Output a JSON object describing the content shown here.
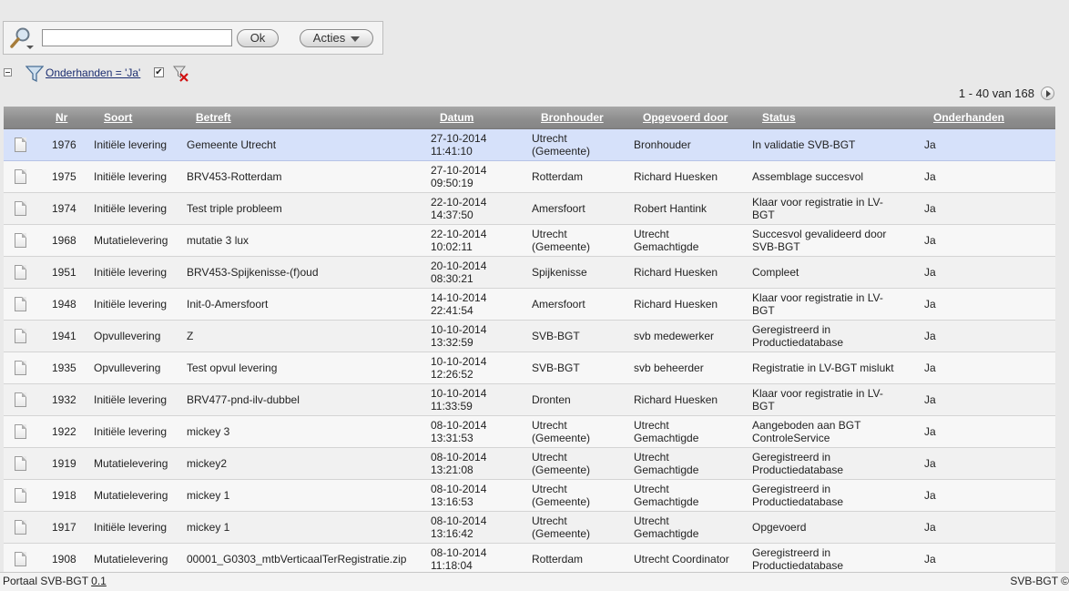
{
  "search": {
    "value": "",
    "ok_label": "Ok",
    "acties_label": "Acties"
  },
  "filter": {
    "label": "Onderhanden = 'Ja'",
    "checked": "✔"
  },
  "pager": {
    "text": "1 - 40 van 168"
  },
  "columns": [
    "Nr",
    "Soort",
    "Betreft",
    "Datum",
    "Bronhouder",
    "Opgevoerd door",
    "Status",
    "Onderhanden"
  ],
  "rows": [
    {
      "nr": "1976",
      "soort": "Initiële levering",
      "betreft": "Gemeente Utrecht",
      "datum": [
        "27-10-2014",
        "11:41:10"
      ],
      "bronhouder": [
        "Utrecht",
        "(Gemeente)"
      ],
      "opgevoerd": [
        "Bronhouder"
      ],
      "status": [
        "In validatie SVB-BGT"
      ],
      "onderhanden": "Ja"
    },
    {
      "nr": "1975",
      "soort": "Initiële levering",
      "betreft": "BRV453-Rotterdam",
      "datum": [
        "27-10-2014",
        "09:50:19"
      ],
      "bronhouder": [
        "Rotterdam"
      ],
      "opgevoerd": [
        "Richard Huesken"
      ],
      "status": [
        "Assemblage succesvol"
      ],
      "onderhanden": "Ja"
    },
    {
      "nr": "1974",
      "soort": "Initiële levering",
      "betreft": "Test triple probleem",
      "datum": [
        "22-10-2014",
        "14:37:50"
      ],
      "bronhouder": [
        "Amersfoort"
      ],
      "opgevoerd": [
        "Robert Hantink"
      ],
      "status": [
        "Klaar voor registratie in LV-",
        "BGT"
      ],
      "onderhanden": "Ja"
    },
    {
      "nr": "1968",
      "soort": "Mutatielevering",
      "betreft": "mutatie 3 lux",
      "datum": [
        "22-10-2014",
        "10:02:11"
      ],
      "bronhouder": [
        "Utrecht",
        "(Gemeente)"
      ],
      "opgevoerd": [
        "Utrecht",
        "Gemachtigde"
      ],
      "status": [
        "Succesvol gevalideerd door",
        "SVB-BGT"
      ],
      "onderhanden": "Ja"
    },
    {
      "nr": "1951",
      "soort": "Initiële levering",
      "betreft": "BRV453-Spijkenisse-(f)oud",
      "datum": [
        "20-10-2014",
        "08:30:21"
      ],
      "bronhouder": [
        "Spijkenisse"
      ],
      "opgevoerd": [
        "Richard Huesken"
      ],
      "status": [
        "Compleet"
      ],
      "onderhanden": "Ja"
    },
    {
      "nr": "1948",
      "soort": "Initiële levering",
      "betreft": "Init-0-Amersfoort",
      "datum": [
        "14-10-2014",
        "22:41:54"
      ],
      "bronhouder": [
        "Amersfoort"
      ],
      "opgevoerd": [
        "Richard Huesken"
      ],
      "status": [
        "Klaar voor registratie in LV-",
        "BGT"
      ],
      "onderhanden": "Ja"
    },
    {
      "nr": "1941",
      "soort": "Opvullevering",
      "betreft": "Z",
      "datum": [
        "10-10-2014",
        "13:32:59"
      ],
      "bronhouder": [
        "SVB-BGT"
      ],
      "opgevoerd": [
        "svb medewerker"
      ],
      "status": [
        "Geregistreerd in",
        "Productiedatabase"
      ],
      "onderhanden": "Ja"
    },
    {
      "nr": "1935",
      "soort": "Opvullevering",
      "betreft": "Test opvul levering",
      "datum": [
        "10-10-2014",
        "12:26:52"
      ],
      "bronhouder": [
        "SVB-BGT"
      ],
      "opgevoerd": [
        "svb beheerder"
      ],
      "status": [
        "Registratie in LV-BGT mislukt"
      ],
      "onderhanden": "Ja"
    },
    {
      "nr": "1932",
      "soort": "Initiële levering",
      "betreft": "BRV477-pnd-ilv-dubbel",
      "datum": [
        "10-10-2014",
        "11:33:59"
      ],
      "bronhouder": [
        "Dronten"
      ],
      "opgevoerd": [
        "Richard Huesken"
      ],
      "status": [
        "Klaar voor registratie in LV-",
        "BGT"
      ],
      "onderhanden": "Ja"
    },
    {
      "nr": "1922",
      "soort": "Initiële levering",
      "betreft": "mickey 3",
      "datum": [
        "08-10-2014",
        "13:31:53"
      ],
      "bronhouder": [
        "Utrecht",
        "(Gemeente)"
      ],
      "opgevoerd": [
        "Utrecht",
        "Gemachtigde"
      ],
      "status": [
        "Aangeboden aan BGT",
        "ControleService"
      ],
      "onderhanden": "Ja"
    },
    {
      "nr": "1919",
      "soort": "Mutatielevering",
      "betreft": "mickey2",
      "datum": [
        "08-10-2014",
        "13:21:08"
      ],
      "bronhouder": [
        "Utrecht",
        "(Gemeente)"
      ],
      "opgevoerd": [
        "Utrecht",
        "Gemachtigde"
      ],
      "status": [
        "Geregistreerd in",
        "Productiedatabase"
      ],
      "onderhanden": "Ja"
    },
    {
      "nr": "1918",
      "soort": "Mutatielevering",
      "betreft": "mickey 1",
      "datum": [
        "08-10-2014",
        "13:16:53"
      ],
      "bronhouder": [
        "Utrecht",
        "(Gemeente)"
      ],
      "opgevoerd": [
        "Utrecht",
        "Gemachtigde"
      ],
      "status": [
        "Geregistreerd in",
        "Productiedatabase"
      ],
      "onderhanden": "Ja"
    },
    {
      "nr": "1917",
      "soort": "Initiële levering",
      "betreft": "mickey 1",
      "datum": [
        "08-10-2014",
        "13:16:42"
      ],
      "bronhouder": [
        "Utrecht",
        "(Gemeente)"
      ],
      "opgevoerd": [
        "Utrecht",
        "Gemachtigde"
      ],
      "status": [
        "Opgevoerd"
      ],
      "onderhanden": "Ja"
    },
    {
      "nr": "1908",
      "soort": "Mutatielevering",
      "betreft": "00001_G0303_mtbVerticaalTerRegistratie.zip",
      "datum": [
        "08-10-2014",
        "11:18:04"
      ],
      "bronhouder": [
        "Rotterdam"
      ],
      "opgevoerd": [
        "Utrecht Coordinator"
      ],
      "status": [
        "Geregistreerd in",
        "Productiedatabase"
      ],
      "onderhanden": "Ja"
    }
  ],
  "footer": {
    "app": "Portaal SVB-BGT",
    "version": "0.1",
    "right": "SVB-BGT ©"
  }
}
